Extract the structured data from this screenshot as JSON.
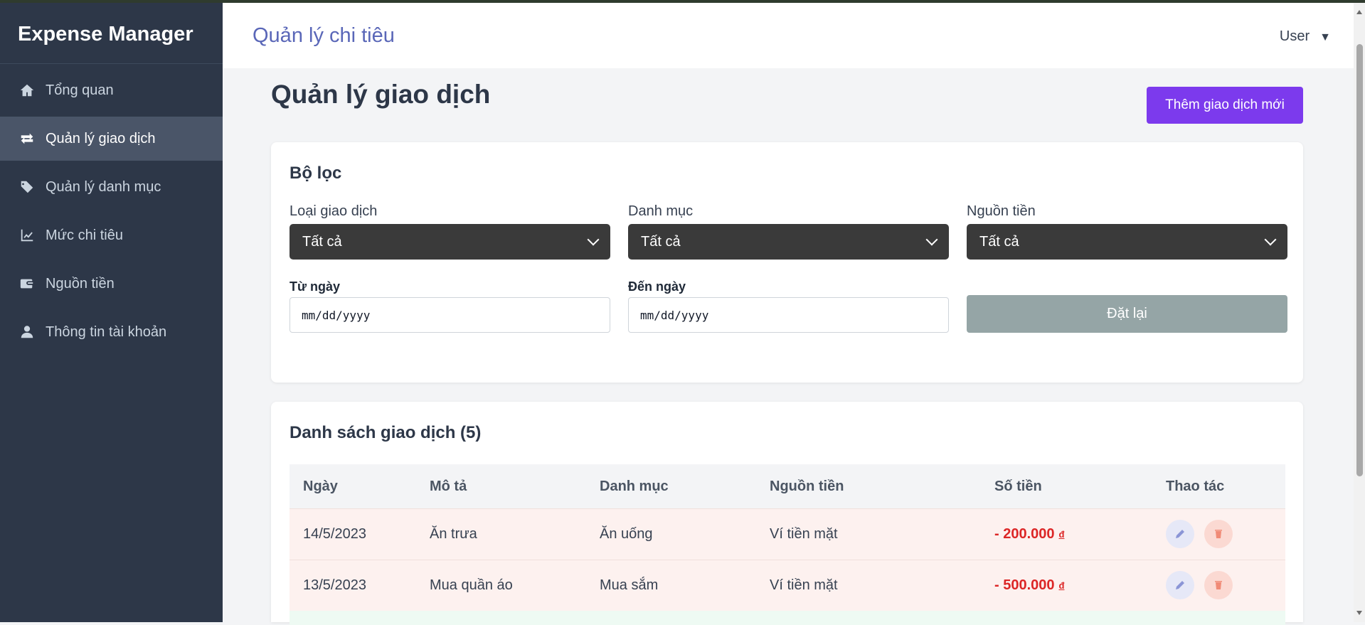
{
  "app": {
    "brand": "Expense Manager"
  },
  "sidebar": {
    "items": [
      {
        "label": "Tổng quan",
        "icon": "home-icon",
        "active": false
      },
      {
        "label": "Quản lý giao dịch",
        "icon": "exchange-arrows-icon",
        "active": true
      },
      {
        "label": "Quản lý danh mục",
        "icon": "tags-icon",
        "active": false
      },
      {
        "label": "Mức chi tiêu",
        "icon": "line-chart-icon",
        "active": false
      },
      {
        "label": "Nguồn tiền",
        "icon": "wallet-icon",
        "active": false
      },
      {
        "label": "Thông tin tài khoản",
        "icon": "user-icon",
        "active": false
      }
    ]
  },
  "header": {
    "title": "Quản lý chi tiêu",
    "user_label": "User",
    "user_caret": "▼"
  },
  "main": {
    "page_title": "Quản lý giao dịch",
    "add_button": "Thêm giao dịch mới",
    "filter": {
      "heading": "Bộ lọc",
      "type_label": "Loại giao dịch",
      "type_value": "Tất cả",
      "category_label": "Danh mục",
      "category_value": "Tất cả",
      "source_label": "Nguồn tiền",
      "source_value": "Tất cả",
      "from_label": "Từ ngày",
      "from_placeholder": "mm/dd/yyyy",
      "to_label": "Đến ngày",
      "to_placeholder": "mm/dd/yyyy",
      "reset_button": "Đặt lại"
    },
    "list": {
      "heading": "Danh sách giao dịch (5)",
      "columns": [
        "Ngày",
        "Mô tả",
        "Danh mục",
        "Nguồn tiền",
        "Số tiền",
        "Thao tác"
      ],
      "rows": [
        {
          "date": "14/5/2023",
          "description": "Ăn trưa",
          "category": "Ăn uống",
          "source": "Ví tiền mặt",
          "amount": "- 200.000",
          "currency": "đ"
        },
        {
          "date": "13/5/2023",
          "description": "Mua quần áo",
          "category": "Mua sắm",
          "source": "Ví tiền mặt",
          "amount": "- 500.000",
          "currency": "đ"
        }
      ]
    }
  },
  "colors": {
    "sidebar_bg": "#2d3748",
    "accent": "#7c3aed",
    "header_title": "#5a67b8",
    "expense_red": "#dc2626",
    "reset_gray": "#95a5a6"
  }
}
